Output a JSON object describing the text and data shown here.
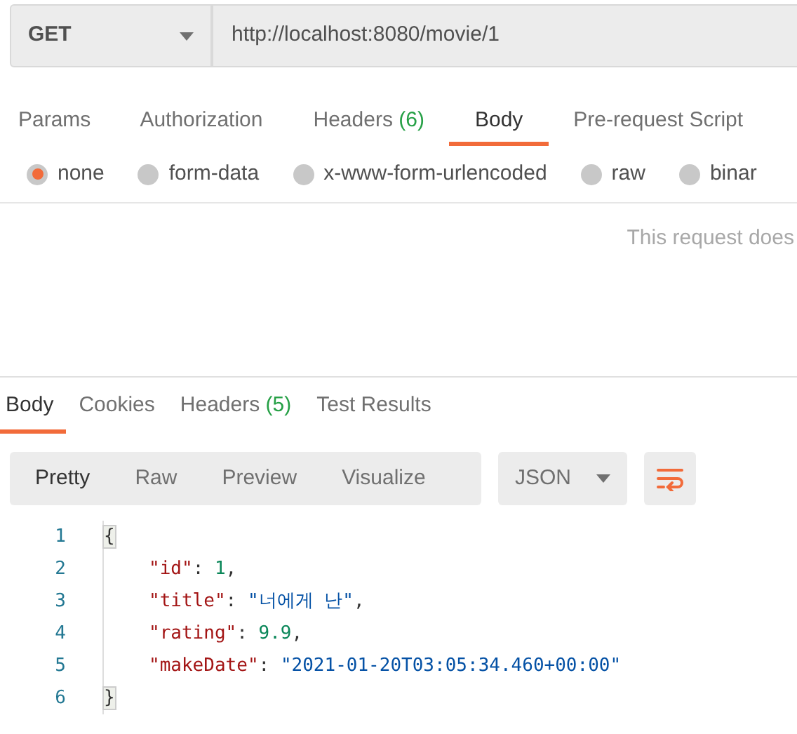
{
  "request": {
    "method": "GET",
    "url": "http://localhost:8080/movie/1"
  },
  "request_tabs": [
    {
      "label": "Params",
      "selected": false
    },
    {
      "label": "Authorization",
      "selected": false
    },
    {
      "label": "Headers",
      "count": "(6)",
      "selected": false
    },
    {
      "label": "Body",
      "selected": true
    },
    {
      "label": "Pre-request Script",
      "selected": false
    }
  ],
  "body_types": [
    {
      "label": "none",
      "selected": true
    },
    {
      "label": "form-data",
      "selected": false
    },
    {
      "label": "x-www-form-urlencoded",
      "selected": false
    },
    {
      "label": "raw",
      "selected": false
    },
    {
      "label": "binar",
      "selected": false
    }
  ],
  "body_message": "This request does",
  "response_tabs": [
    {
      "label": "Body",
      "selected": true
    },
    {
      "label": "Cookies",
      "selected": false
    },
    {
      "label": "Headers",
      "count": "(5)",
      "selected": false
    },
    {
      "label": "Test Results",
      "selected": false
    }
  ],
  "view_modes": [
    {
      "label": "Pretty",
      "selected": true
    },
    {
      "label": "Raw",
      "selected": false
    },
    {
      "label": "Preview",
      "selected": false
    },
    {
      "label": "Visualize",
      "selected": false
    }
  ],
  "format": "JSON",
  "code_lines": [
    {
      "number": "1",
      "indented": false,
      "tokens": [
        {
          "kind": "brace",
          "text": "{"
        }
      ]
    },
    {
      "number": "2",
      "indented": true,
      "tokens": [
        {
          "kind": "key",
          "text": "\"id\""
        },
        {
          "kind": "punct",
          "text": ": "
        },
        {
          "kind": "number",
          "text": "1"
        },
        {
          "kind": "punct",
          "text": ","
        }
      ]
    },
    {
      "number": "3",
      "indented": true,
      "tokens": [
        {
          "kind": "key",
          "text": "\"title\""
        },
        {
          "kind": "punct",
          "text": ": "
        },
        {
          "kind": "string",
          "text": "\"너에게 난\""
        },
        {
          "kind": "punct",
          "text": ","
        }
      ]
    },
    {
      "number": "4",
      "indented": true,
      "tokens": [
        {
          "kind": "key",
          "text": "\"rating\""
        },
        {
          "kind": "punct",
          "text": ": "
        },
        {
          "kind": "number",
          "text": "9.9"
        },
        {
          "kind": "punct",
          "text": ","
        }
      ]
    },
    {
      "number": "5",
      "indented": true,
      "tokens": [
        {
          "kind": "key",
          "text": "\"makeDate\""
        },
        {
          "kind": "punct",
          "text": ": "
        },
        {
          "kind": "string",
          "text": "\"2021-01-20T03:05:34.460+00:00\""
        }
      ]
    },
    {
      "number": "6",
      "indented": false,
      "tokens": [
        {
          "kind": "brace",
          "text": "}"
        }
      ]
    }
  ]
}
